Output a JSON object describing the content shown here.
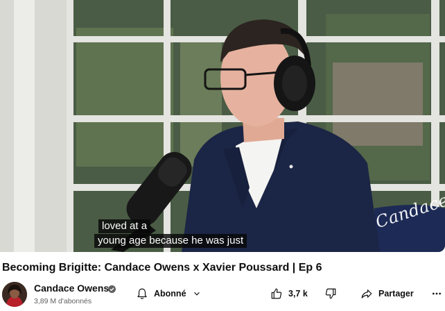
{
  "video": {
    "caption_lines": [
      "loved at a",
      "young age because he was just"
    ],
    "watermark": "Candace"
  },
  "title": "Becoming Brigitte: Candace Owens x Xavier Poussard | Ep 6",
  "channel": {
    "name": "Candace Owens",
    "subscribers": "3,89 M d'abonnés"
  },
  "actions": {
    "subscribe_label": "Abonné",
    "like_count": "3,7 k",
    "share_label": "Partager"
  },
  "icons": [
    "verified-icon",
    "bell-icon",
    "chevron-down-icon",
    "thumb-up-icon",
    "thumb-down-icon",
    "share-icon",
    "more-icon"
  ]
}
